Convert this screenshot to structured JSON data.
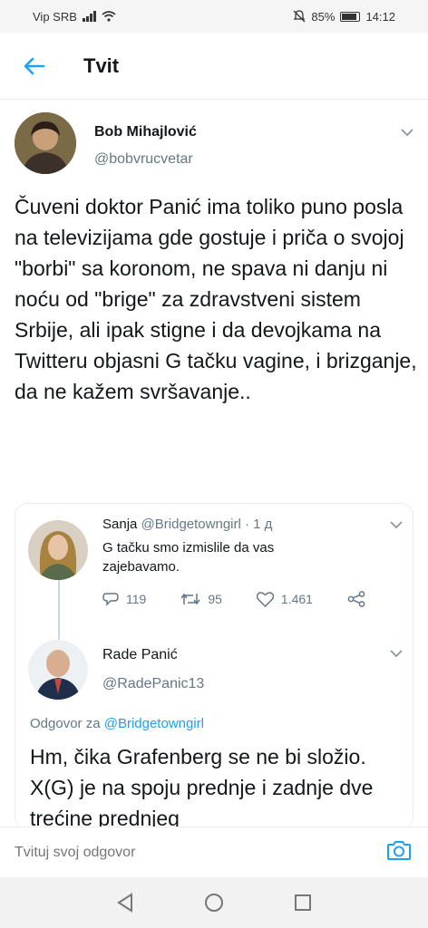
{
  "status_bar": {
    "carrier": "Vip SRB",
    "battery": "85%",
    "time": "14:12",
    "icons": [
      "signal-icon",
      "wifi-icon",
      "mute-icon",
      "battery-icon"
    ]
  },
  "app_bar": {
    "title": "Tvit",
    "back_icon": "arrow-left-icon"
  },
  "tweet": {
    "author_name": "Bob Mihajlović",
    "author_handle": "@bobvrucvetar",
    "text": "Čuveni doktor Panić ima toliko puno posla na televizijama gde gostuje i priča o svojoj \"borbi\" sa koronom, ne spava ni danju ni noću od \"brige\" za zdravstveni sistem Srbije, ali ipak stigne i da devojkama na Twitteru objasni G tačku vagine, i brizganje, da ne kažem svršavanje.."
  },
  "thread": {
    "reply1": {
      "name": "Sanja",
      "handle": "@Bridgetowngirl",
      "time": "· 1 д",
      "text": "G tačku smo izmislile da vas zajebavamo.",
      "stats": {
        "replies": "119",
        "retweets": "95",
        "likes": "1.461"
      }
    },
    "reply2": {
      "name": "Rade Panić",
      "handle": "@RadePanic13",
      "reply_to_label": "Odgovor za",
      "reply_to_handle": "@Bridgetowngirl",
      "text": "Hm, čika Grafenberg se ne bi složio. X(G) je na spoju prednje i zadnje dve trećine prednjeg"
    }
  },
  "composer": {
    "placeholder": "Tvituj svoj odgovor",
    "camera_icon": "camera-icon"
  },
  "colors": {
    "accent": "#1da1f2",
    "text": "#14171a",
    "muted": "#657786",
    "divider": "#e6ecf0"
  }
}
